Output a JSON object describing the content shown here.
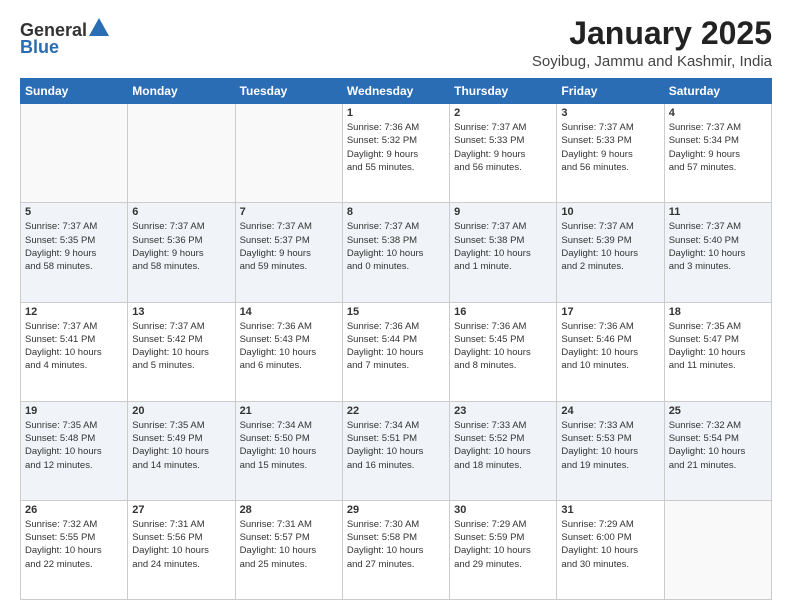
{
  "header": {
    "logo_general": "General",
    "logo_blue": "Blue",
    "month": "January 2025",
    "location": "Soyibug, Jammu and Kashmir, India"
  },
  "weekdays": [
    "Sunday",
    "Monday",
    "Tuesday",
    "Wednesday",
    "Thursday",
    "Friday",
    "Saturday"
  ],
  "weeks": [
    [
      {
        "day": "",
        "info": ""
      },
      {
        "day": "",
        "info": ""
      },
      {
        "day": "",
        "info": ""
      },
      {
        "day": "1",
        "info": "Sunrise: 7:36 AM\nSunset: 5:32 PM\nDaylight: 9 hours\nand 55 minutes."
      },
      {
        "day": "2",
        "info": "Sunrise: 7:37 AM\nSunset: 5:33 PM\nDaylight: 9 hours\nand 56 minutes."
      },
      {
        "day": "3",
        "info": "Sunrise: 7:37 AM\nSunset: 5:33 PM\nDaylight: 9 hours\nand 56 minutes."
      },
      {
        "day": "4",
        "info": "Sunrise: 7:37 AM\nSunset: 5:34 PM\nDaylight: 9 hours\nand 57 minutes."
      }
    ],
    [
      {
        "day": "5",
        "info": "Sunrise: 7:37 AM\nSunset: 5:35 PM\nDaylight: 9 hours\nand 58 minutes."
      },
      {
        "day": "6",
        "info": "Sunrise: 7:37 AM\nSunset: 5:36 PM\nDaylight: 9 hours\nand 58 minutes."
      },
      {
        "day": "7",
        "info": "Sunrise: 7:37 AM\nSunset: 5:37 PM\nDaylight: 9 hours\nand 59 minutes."
      },
      {
        "day": "8",
        "info": "Sunrise: 7:37 AM\nSunset: 5:38 PM\nDaylight: 10 hours\nand 0 minutes."
      },
      {
        "day": "9",
        "info": "Sunrise: 7:37 AM\nSunset: 5:38 PM\nDaylight: 10 hours\nand 1 minute."
      },
      {
        "day": "10",
        "info": "Sunrise: 7:37 AM\nSunset: 5:39 PM\nDaylight: 10 hours\nand 2 minutes."
      },
      {
        "day": "11",
        "info": "Sunrise: 7:37 AM\nSunset: 5:40 PM\nDaylight: 10 hours\nand 3 minutes."
      }
    ],
    [
      {
        "day": "12",
        "info": "Sunrise: 7:37 AM\nSunset: 5:41 PM\nDaylight: 10 hours\nand 4 minutes."
      },
      {
        "day": "13",
        "info": "Sunrise: 7:37 AM\nSunset: 5:42 PM\nDaylight: 10 hours\nand 5 minutes."
      },
      {
        "day": "14",
        "info": "Sunrise: 7:36 AM\nSunset: 5:43 PM\nDaylight: 10 hours\nand 6 minutes."
      },
      {
        "day": "15",
        "info": "Sunrise: 7:36 AM\nSunset: 5:44 PM\nDaylight: 10 hours\nand 7 minutes."
      },
      {
        "day": "16",
        "info": "Sunrise: 7:36 AM\nSunset: 5:45 PM\nDaylight: 10 hours\nand 8 minutes."
      },
      {
        "day": "17",
        "info": "Sunrise: 7:36 AM\nSunset: 5:46 PM\nDaylight: 10 hours\nand 10 minutes."
      },
      {
        "day": "18",
        "info": "Sunrise: 7:35 AM\nSunset: 5:47 PM\nDaylight: 10 hours\nand 11 minutes."
      }
    ],
    [
      {
        "day": "19",
        "info": "Sunrise: 7:35 AM\nSunset: 5:48 PM\nDaylight: 10 hours\nand 12 minutes."
      },
      {
        "day": "20",
        "info": "Sunrise: 7:35 AM\nSunset: 5:49 PM\nDaylight: 10 hours\nand 14 minutes."
      },
      {
        "day": "21",
        "info": "Sunrise: 7:34 AM\nSunset: 5:50 PM\nDaylight: 10 hours\nand 15 minutes."
      },
      {
        "day": "22",
        "info": "Sunrise: 7:34 AM\nSunset: 5:51 PM\nDaylight: 10 hours\nand 16 minutes."
      },
      {
        "day": "23",
        "info": "Sunrise: 7:33 AM\nSunset: 5:52 PM\nDaylight: 10 hours\nand 18 minutes."
      },
      {
        "day": "24",
        "info": "Sunrise: 7:33 AM\nSunset: 5:53 PM\nDaylight: 10 hours\nand 19 minutes."
      },
      {
        "day": "25",
        "info": "Sunrise: 7:32 AM\nSunset: 5:54 PM\nDaylight: 10 hours\nand 21 minutes."
      }
    ],
    [
      {
        "day": "26",
        "info": "Sunrise: 7:32 AM\nSunset: 5:55 PM\nDaylight: 10 hours\nand 22 minutes."
      },
      {
        "day": "27",
        "info": "Sunrise: 7:31 AM\nSunset: 5:56 PM\nDaylight: 10 hours\nand 24 minutes."
      },
      {
        "day": "28",
        "info": "Sunrise: 7:31 AM\nSunset: 5:57 PM\nDaylight: 10 hours\nand 25 minutes."
      },
      {
        "day": "29",
        "info": "Sunrise: 7:30 AM\nSunset: 5:58 PM\nDaylight: 10 hours\nand 27 minutes."
      },
      {
        "day": "30",
        "info": "Sunrise: 7:29 AM\nSunset: 5:59 PM\nDaylight: 10 hours\nand 29 minutes."
      },
      {
        "day": "31",
        "info": "Sunrise: 7:29 AM\nSunset: 6:00 PM\nDaylight: 10 hours\nand 30 minutes."
      },
      {
        "day": "",
        "info": ""
      }
    ]
  ]
}
